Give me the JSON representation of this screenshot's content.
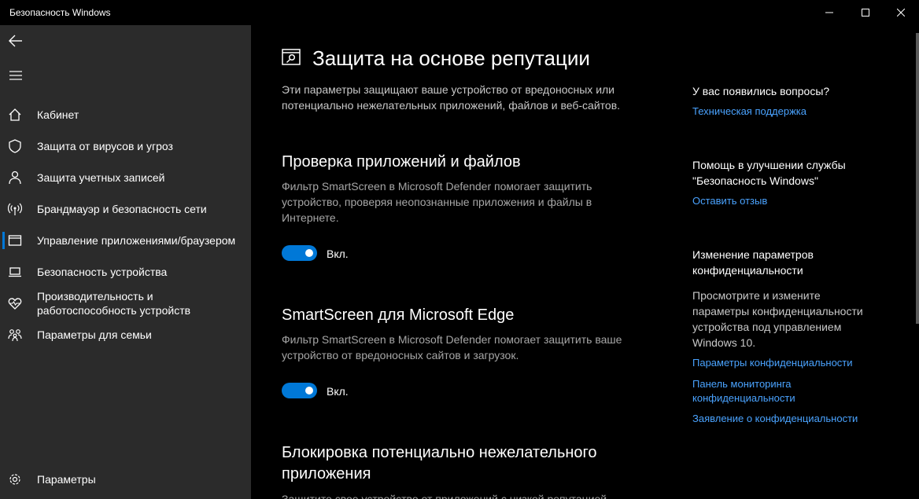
{
  "window": {
    "title": "Безопасность Windows"
  },
  "sidebar": {
    "items": [
      {
        "label": "Кабинет",
        "icon": "home-icon"
      },
      {
        "label": "Защита от вирусов и угроз",
        "icon": "shield-icon"
      },
      {
        "label": "Защита учетных записей",
        "icon": "person-icon"
      },
      {
        "label": "Брандмауэр и безопасность сети",
        "icon": "wifi-antenna-icon"
      },
      {
        "label": "Управление приложениями/браузером",
        "icon": "app-browser-icon",
        "selected": true
      },
      {
        "label": "Безопасность устройства",
        "icon": "laptop-icon"
      },
      {
        "label_line1": "Производительность и",
        "label_line2": "работоспособность устройств",
        "icon": "heart-pulse-icon"
      },
      {
        "label": "Параметры для семьи",
        "icon": "family-icon"
      }
    ],
    "settings_label": "Параметры"
  },
  "main": {
    "title": "Защита на основе репутации",
    "description_line1": "Эти параметры защищают ваше устройство от вредоносных или",
    "description_line2": "потенциально нежелательных приложений, файлов и веб-сайтов.",
    "sections": [
      {
        "title": "Проверка приложений и файлов",
        "desc_line1": "Фильтр SmartScreen в Microsoft Defender помогает защитить",
        "desc_line2": "устройство, проверяя неопознанные приложения и файлы в",
        "desc_line3": "Интернете.",
        "toggle_on": true,
        "toggle_label": "Вкл."
      },
      {
        "title": "SmartScreen для Microsoft Edge",
        "desc_line1": "Фильтр SmartScreen в Microsoft Defender помогает защитить ваше",
        "desc_line2": "устройство от вредоносных сайтов и загрузок.",
        "toggle_on": true,
        "toggle_label": "Вкл."
      },
      {
        "title_line1": "Блокировка потенциально нежелательного",
        "title_line2": "приложения",
        "desc_partial": "Защитите свое устройство от приложений с низкой репутацией"
      }
    ]
  },
  "right": {
    "questions_heading": "У вас появились вопросы?",
    "support_link": "Техническая поддержка",
    "improve_heading_line1": "Помощь в улучшении службы",
    "improve_heading_line2": "\"Безопасность Windows\"",
    "feedback_link": "Оставить отзыв",
    "privacy_heading_line1": "Изменение параметров",
    "privacy_heading_line2": "конфиденциальности",
    "privacy_text_line1": "Просмотрите и измените",
    "privacy_text_line2": "параметры конфиденциальности",
    "privacy_text_line3": "устройства под управлением",
    "privacy_text_line4": "Windows 10.",
    "privacy_settings_link": "Параметры конфиденциальности",
    "privacy_dashboard_link_line1": "Панель мониторинга",
    "privacy_dashboard_link_line2": "конфиденциальности",
    "privacy_statement_link": "Заявление о конфиденциальности"
  },
  "colors": {
    "accent": "#0078d7",
    "link": "#4aa3ff",
    "sidebar_bg": "#2b2b2b",
    "main_bg": "#000000"
  }
}
